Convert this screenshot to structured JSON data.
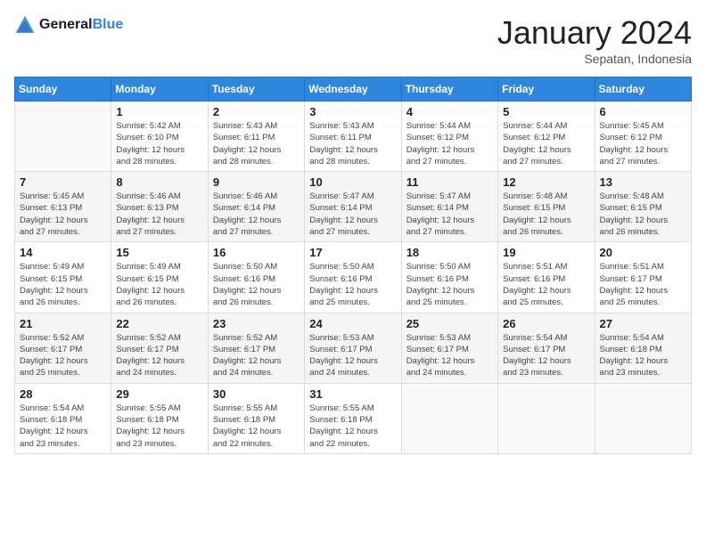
{
  "header": {
    "logo_line1": "General",
    "logo_line2": "Blue",
    "month_title": "January 2024",
    "location": "Sepatan, Indonesia"
  },
  "days_of_week": [
    "Sunday",
    "Monday",
    "Tuesday",
    "Wednesday",
    "Thursday",
    "Friday",
    "Saturday"
  ],
  "weeks": [
    [
      {
        "day": "",
        "info": ""
      },
      {
        "day": "1",
        "info": "Sunrise: 5:42 AM\nSunset: 6:10 PM\nDaylight: 12 hours\nand 28 minutes."
      },
      {
        "day": "2",
        "info": "Sunrise: 5:43 AM\nSunset: 6:11 PM\nDaylight: 12 hours\nand 28 minutes."
      },
      {
        "day": "3",
        "info": "Sunrise: 5:43 AM\nSunset: 6:11 PM\nDaylight: 12 hours\nand 28 minutes."
      },
      {
        "day": "4",
        "info": "Sunrise: 5:44 AM\nSunset: 6:12 PM\nDaylight: 12 hours\nand 27 minutes."
      },
      {
        "day": "5",
        "info": "Sunrise: 5:44 AM\nSunset: 6:12 PM\nDaylight: 12 hours\nand 27 minutes."
      },
      {
        "day": "6",
        "info": "Sunrise: 5:45 AM\nSunset: 6:12 PM\nDaylight: 12 hours\nand 27 minutes."
      }
    ],
    [
      {
        "day": "7",
        "info": "Sunrise: 5:45 AM\nSunset: 6:13 PM\nDaylight: 12 hours\nand 27 minutes."
      },
      {
        "day": "8",
        "info": "Sunrise: 5:46 AM\nSunset: 6:13 PM\nDaylight: 12 hours\nand 27 minutes."
      },
      {
        "day": "9",
        "info": "Sunrise: 5:46 AM\nSunset: 6:14 PM\nDaylight: 12 hours\nand 27 minutes."
      },
      {
        "day": "10",
        "info": "Sunrise: 5:47 AM\nSunset: 6:14 PM\nDaylight: 12 hours\nand 27 minutes."
      },
      {
        "day": "11",
        "info": "Sunrise: 5:47 AM\nSunset: 6:14 PM\nDaylight: 12 hours\nand 27 minutes."
      },
      {
        "day": "12",
        "info": "Sunrise: 5:48 AM\nSunset: 6:15 PM\nDaylight: 12 hours\nand 26 minutes."
      },
      {
        "day": "13",
        "info": "Sunrise: 5:48 AM\nSunset: 6:15 PM\nDaylight: 12 hours\nand 26 minutes."
      }
    ],
    [
      {
        "day": "14",
        "info": "Sunrise: 5:49 AM\nSunset: 6:15 PM\nDaylight: 12 hours\nand 26 minutes."
      },
      {
        "day": "15",
        "info": "Sunrise: 5:49 AM\nSunset: 6:15 PM\nDaylight: 12 hours\nand 26 minutes."
      },
      {
        "day": "16",
        "info": "Sunrise: 5:50 AM\nSunset: 6:16 PM\nDaylight: 12 hours\nand 26 minutes."
      },
      {
        "day": "17",
        "info": "Sunrise: 5:50 AM\nSunset: 6:16 PM\nDaylight: 12 hours\nand 25 minutes."
      },
      {
        "day": "18",
        "info": "Sunrise: 5:50 AM\nSunset: 6:16 PM\nDaylight: 12 hours\nand 25 minutes."
      },
      {
        "day": "19",
        "info": "Sunrise: 5:51 AM\nSunset: 6:16 PM\nDaylight: 12 hours\nand 25 minutes."
      },
      {
        "day": "20",
        "info": "Sunrise: 5:51 AM\nSunset: 6:17 PM\nDaylight: 12 hours\nand 25 minutes."
      }
    ],
    [
      {
        "day": "21",
        "info": "Sunrise: 5:52 AM\nSunset: 6:17 PM\nDaylight: 12 hours\nand 25 minutes."
      },
      {
        "day": "22",
        "info": "Sunrise: 5:52 AM\nSunset: 6:17 PM\nDaylight: 12 hours\nand 24 minutes."
      },
      {
        "day": "23",
        "info": "Sunrise: 5:52 AM\nSunset: 6:17 PM\nDaylight: 12 hours\nand 24 minutes."
      },
      {
        "day": "24",
        "info": "Sunrise: 5:53 AM\nSunset: 6:17 PM\nDaylight: 12 hours\nand 24 minutes."
      },
      {
        "day": "25",
        "info": "Sunrise: 5:53 AM\nSunset: 6:17 PM\nDaylight: 12 hours\nand 24 minutes."
      },
      {
        "day": "26",
        "info": "Sunrise: 5:54 AM\nSunset: 6:17 PM\nDaylight: 12 hours\nand 23 minutes."
      },
      {
        "day": "27",
        "info": "Sunrise: 5:54 AM\nSunset: 6:18 PM\nDaylight: 12 hours\nand 23 minutes."
      }
    ],
    [
      {
        "day": "28",
        "info": "Sunrise: 5:54 AM\nSunset: 6:18 PM\nDaylight: 12 hours\nand 23 minutes."
      },
      {
        "day": "29",
        "info": "Sunrise: 5:55 AM\nSunset: 6:18 PM\nDaylight: 12 hours\nand 23 minutes."
      },
      {
        "day": "30",
        "info": "Sunrise: 5:55 AM\nSunset: 6:18 PM\nDaylight: 12 hours\nand 22 minutes."
      },
      {
        "day": "31",
        "info": "Sunrise: 5:55 AM\nSunset: 6:18 PM\nDaylight: 12 hours\nand 22 minutes."
      },
      {
        "day": "",
        "info": ""
      },
      {
        "day": "",
        "info": ""
      },
      {
        "day": "",
        "info": ""
      }
    ]
  ]
}
